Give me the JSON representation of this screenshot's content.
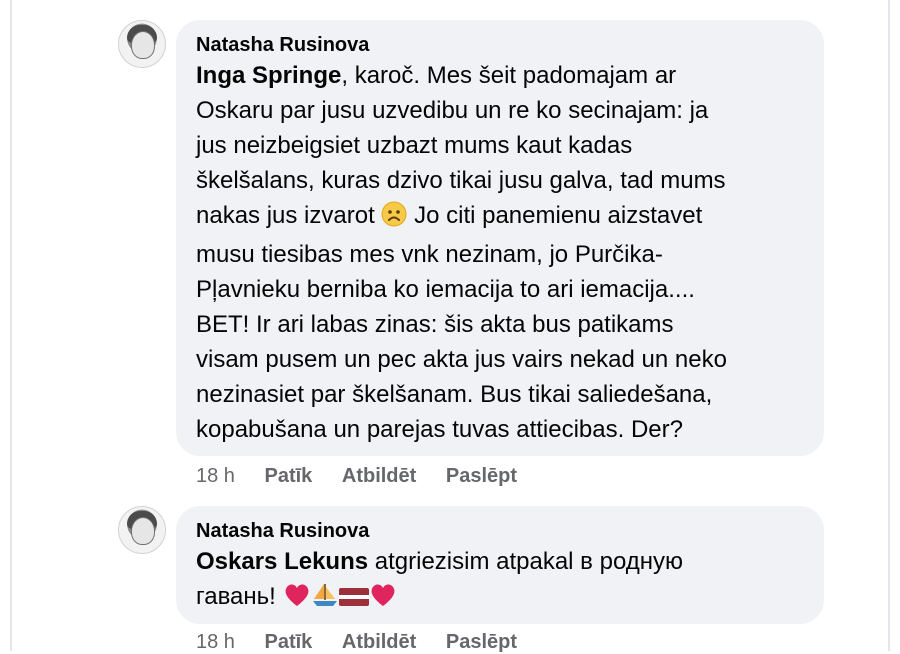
{
  "comments": [
    {
      "author": "Natasha Rusinova",
      "mention": "Inga Springe",
      "lines": [
        ", karoč. Mes šeit padomajam ar",
        "Oskaru par jusu uzvedibu un re ko secinajam: ja",
        "jus neizbeigsiet uzbazt mums kaut kadas",
        "škelšalans, kuras dzivo tikai jusu galva, tad mums",
        "nakas jus izvarot ",
        " Jo citi panemienu aizstavet",
        "musu tiesibas mes vnk nezinam, jo Purčika-",
        "Pļavnieku berniba ko iemacija to ari iemacija....",
        "BET! Ir ari labas zinas: šis akta bus patikams",
        "visam pusem un pec akta jus vairs nekad un neko",
        "nezinasiet par škelšanam. Bus tikai saliedešana,",
        "kopabušana un parejas tuvas attiecibas. Der?"
      ],
      "emoji": "sad-face-emoji",
      "time": "18 h",
      "actions": {
        "like": "Patīk",
        "reply": "Atbildēt",
        "hide": "Paslēpt"
      }
    },
    {
      "author": "Natasha Rusinova",
      "mention": "Oskars Lekuns",
      "line1": " atgriezisim atpakal в родную",
      "line2": "гавань! ",
      "emojis": [
        "red-heart-emoji",
        "sailboat-emoji",
        "latvia-flag-emoji",
        "red-heart-emoji"
      ],
      "time": "18 h",
      "actions": {
        "like": "Patīk",
        "reply": "Atbildēt",
        "hide": "Paslēpt"
      }
    }
  ],
  "colors": {
    "bubble": "#f0f2f5",
    "text": "#050505",
    "meta": "#65676b",
    "heart": "#e0245e",
    "flag_red": "#9e3039"
  }
}
